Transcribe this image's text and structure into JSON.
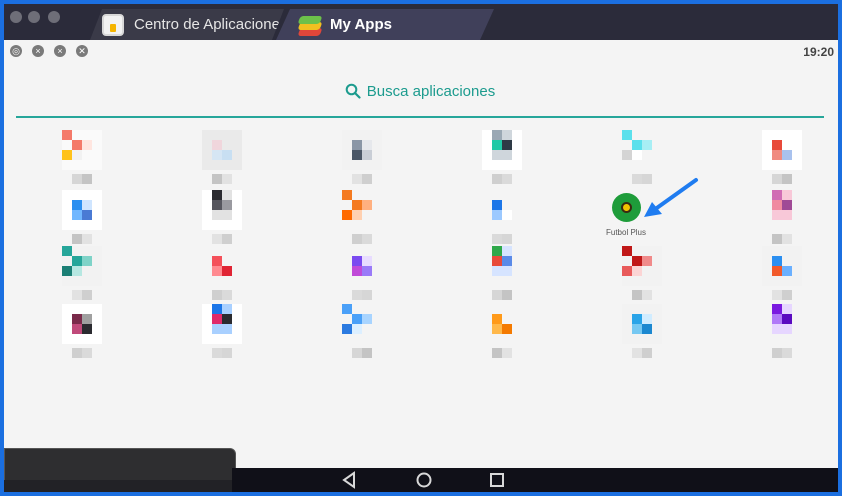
{
  "window": {
    "tabs": [
      {
        "label": "Centro de Aplicaciones",
        "icon": "app-center-icon",
        "active": false
      },
      {
        "label": "My Apps",
        "icon": "bluestacks-layers-icon",
        "active": true
      }
    ]
  },
  "statusbar": {
    "time": "19:20",
    "notification_icons": [
      "shield-icon",
      "close-badge-icon",
      "close-badge-icon",
      "shield-icon"
    ]
  },
  "search": {
    "placeholder": "Busca aplicaciones",
    "icon": "search-icon",
    "accent_color": "#26a69a"
  },
  "apps": {
    "highlighted": {
      "label": "Futbol Plus",
      "icon": "soccer-ball-icon",
      "color": "#1e9c3a"
    },
    "obscured_count": 23
  },
  "annotation": {
    "arrow_color": "#1f7cf0"
  },
  "navbar": {
    "buttons": [
      "back-icon",
      "home-icon",
      "recents-icon"
    ]
  }
}
